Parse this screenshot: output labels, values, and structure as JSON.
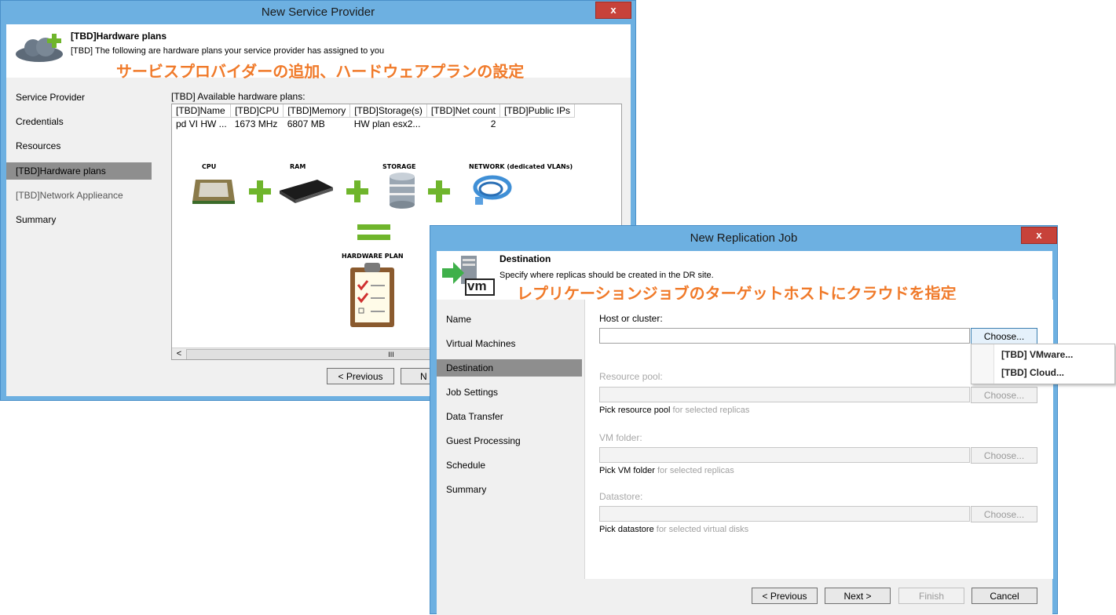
{
  "sp_window": {
    "title": "New Service Provider",
    "close_label": "x",
    "header_title": "[TBD]Hardware plans",
    "header_subtitle": "[TBD] The following are hardware plans your service provider has assigned to you",
    "annotation": "サービスプロバイダーの追加、ハードウェアプランの設定",
    "sidebar": [
      {
        "label": "Service Provider"
      },
      {
        "label": "Credentials"
      },
      {
        "label": "Resources"
      },
      {
        "label": "[TBD]Hardware plans"
      },
      {
        "label": "[TBD]Network Applieance"
      },
      {
        "label": "Summary"
      }
    ],
    "plans_label": "[TBD] Available hardware plans:",
    "table": {
      "columns": [
        "[TBD]Name",
        "[TBD]CPU",
        "[TBD]Memory",
        "[TBD]Storage(s)",
        "[TBD]Net count",
        "[TBD]Public IPs"
      ],
      "rows": [
        [
          "pd VI HW ...",
          "1673 MHz",
          "6807 MB",
          "HW plan esx2...",
          "2",
          ""
        ]
      ]
    },
    "diagram": {
      "cpu": "CPU",
      "ram": "RAM",
      "storage": "STORAGE",
      "network": "NETWORK (dedicated VLANs)",
      "hardware_plan": "HARDWARE PLAN"
    },
    "scroll_left": "<",
    "scroll_thumb": "III",
    "previous_label": "< Previous",
    "next_label_partial": "N"
  },
  "rj_window": {
    "title": "New Replication Job",
    "close_label": "x",
    "header_title": "Destination",
    "header_subtitle": "Specify where replicas should be created in the DR site.",
    "vm_badge": "vm",
    "annotation": "レプリケーションジョブのターゲットホストにクラウドを指定",
    "sidebar": [
      {
        "label": "Name"
      },
      {
        "label": "Virtual Machines"
      },
      {
        "label": "Destination"
      },
      {
        "label": "Job Settings"
      },
      {
        "label": "Data Transfer"
      },
      {
        "label": "Guest Processing"
      },
      {
        "label": "Schedule"
      },
      {
        "label": "Summary"
      }
    ],
    "host_label": "Host or cluster:",
    "choose_label": "Choose...",
    "menu": [
      "[TBD] VMware...",
      "[TBD] Cloud..."
    ],
    "resource_pool_label": "Resource pool:",
    "resource_pool_hint_bold": "Pick resource pool",
    "resource_pool_hint_rest": " for selected replicas",
    "vm_folder_label": "VM folder:",
    "vm_folder_hint_bold": "Pick VM folder",
    "vm_folder_hint_rest": " for selected replicas",
    "datastore_label": "Datastore:",
    "datastore_hint_bold": "Pick datastore",
    "datastore_hint_rest": " for selected virtual disks",
    "buttons": {
      "previous": "< Previous",
      "next": "Next >",
      "finish": "Finish",
      "cancel": "Cancel"
    }
  },
  "colors": {
    "frame": "#6db0e1",
    "annotation": "#f07a2a",
    "close": "#c7423a",
    "selected": "#8e8e8e",
    "plus": "#6fb52c"
  }
}
